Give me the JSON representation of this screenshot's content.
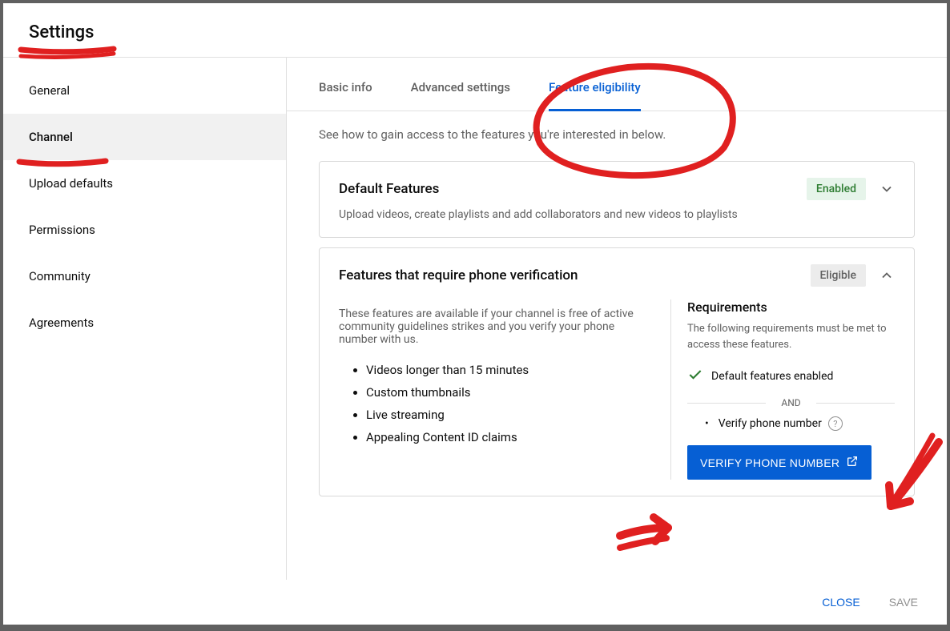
{
  "header": {
    "title": "Settings"
  },
  "sidebar": {
    "items": [
      {
        "label": "General"
      },
      {
        "label": "Channel"
      },
      {
        "label": "Upload defaults"
      },
      {
        "label": "Permissions"
      },
      {
        "label": "Community"
      },
      {
        "label": "Agreements"
      }
    ]
  },
  "tabs": {
    "items": [
      {
        "label": "Basic info"
      },
      {
        "label": "Advanced settings"
      },
      {
        "label": "Feature eligibility"
      }
    ]
  },
  "intro": "See how to gain access to the features you're interested in below.",
  "default_card": {
    "title": "Default Features",
    "desc": "Upload videos, create playlists and add collaborators and new videos to playlists",
    "badge": "Enabled"
  },
  "phone_card": {
    "title": "Features that require phone verification",
    "badge": "Eligible",
    "desc": "These features are available if your channel is free of active community guidelines strikes and you verify your phone number with us.",
    "features": [
      "Videos longer than 15 minutes",
      "Custom thumbnails",
      "Live streaming",
      "Appealing Content ID claims"
    ],
    "requirements": {
      "title": "Requirements",
      "desc": "The following requirements must be met to access these features.",
      "met": "Default features enabled",
      "and": "AND",
      "pending": "Verify phone number",
      "button": "VERIFY PHONE NUMBER"
    }
  },
  "footer": {
    "close": "CLOSE",
    "save": "SAVE"
  }
}
